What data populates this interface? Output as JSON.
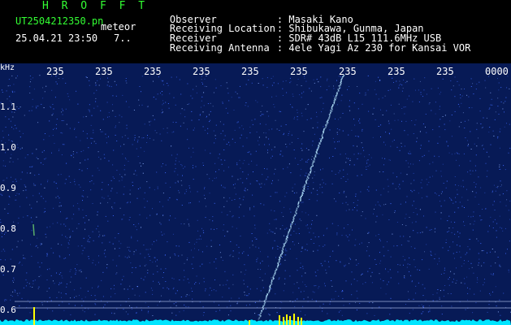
{
  "header": {
    "logo_text": "H R O F F T",
    "file_name": "UT2504212350.pn",
    "meteor_label": "meteor",
    "datetime": "25.04.21 23:50",
    "count": "7.."
  },
  "info": [
    {
      "key": "Observer",
      "value": ": Masaki Kano"
    },
    {
      "key": "Receiving Location",
      "value": ": Shibukawa, Gunma, Japan"
    },
    {
      "key": "Receiver",
      "value": ": SDR# 43dB L15 111.6MHz USB"
    },
    {
      "key": "Receiving Antenna",
      "value": ": 4ele Yagi Az 230 for Kansai VOR"
    }
  ],
  "plot": {
    "y_unit": "kHz",
    "y_ticks": [
      "1.1",
      "1.0",
      "0.9",
      "0.8",
      "0.7",
      "0.6"
    ],
    "x_ticks": [
      "235",
      "235",
      "235",
      "235",
      "235",
      "235",
      "235",
      "235",
      "235",
      "0000"
    ]
  },
  "colors": {
    "background": "#071a56",
    "noise": "#3f6bff",
    "trail": "#b8e8ff",
    "baseline": "#00e5ff",
    "spike": "#ffff00",
    "header_green": "#33ff33"
  }
}
